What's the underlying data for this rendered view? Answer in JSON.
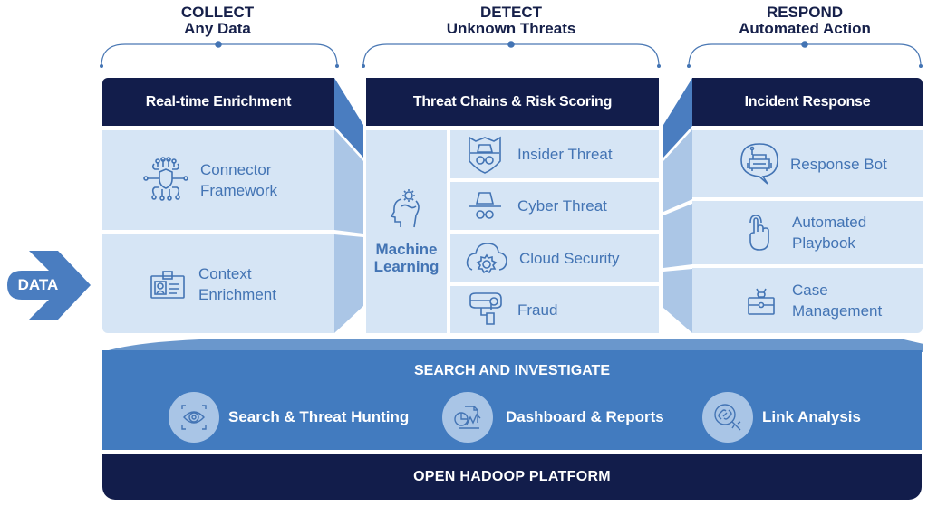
{
  "phases": [
    {
      "title": "COLLECT",
      "subtitle": "Any Data"
    },
    {
      "title": "DETECT",
      "subtitle": "Unknown Threats"
    },
    {
      "title": "RESPOND",
      "subtitle": "Automated Action"
    }
  ],
  "input": {
    "label": "DATA"
  },
  "collect": {
    "header": "Real-time Enrichment",
    "items": [
      {
        "icon": "circuit-shield-icon",
        "line1": "Connector",
        "line2": "Framework"
      },
      {
        "icon": "id-badge-icon",
        "line1": "Context",
        "line2": "Enrichment"
      }
    ]
  },
  "detect": {
    "header": "Threat Chains & Risk Scoring",
    "ml": {
      "icon": "head-gear-icon",
      "line1": "Machine",
      "line2": "Learning"
    },
    "items": [
      {
        "icon": "spy-shield-icon",
        "label": "Insider Threat"
      },
      {
        "icon": "spy-hat-icon",
        "label": "Cyber Threat"
      },
      {
        "icon": "cloud-gear-icon",
        "label": "Cloud Security"
      },
      {
        "icon": "security-camera-icon",
        "label": "Fraud"
      }
    ]
  },
  "respond": {
    "header": "Incident Response",
    "items": [
      {
        "icon": "robot-chat-icon",
        "line1": "Response Bot",
        "line2": ""
      },
      {
        "icon": "hand-pointer-icon",
        "line1": "Automated",
        "line2": "Playbook"
      },
      {
        "icon": "briefcase-user-icon",
        "line1": "Case",
        "line2": "Management"
      }
    ]
  },
  "search": {
    "title": "SEARCH AND INVESTIGATE",
    "features": [
      {
        "icon": "eye-scan-icon",
        "label": "Search & Threat Hunting"
      },
      {
        "icon": "dashboard-chart-icon",
        "label": "Dashboard & Reports"
      },
      {
        "icon": "link-magnifier-icon",
        "label": "Link Analysis"
      }
    ]
  },
  "platform": {
    "label": "OPEN HADOOP PLATFORM"
  },
  "colors": {
    "navy": "#121d4b",
    "accent_blue": "#427bbf",
    "light_panel": "#d6e5f5",
    "side_panel": "#a9c5e6",
    "text_blue": "#4374b4"
  }
}
